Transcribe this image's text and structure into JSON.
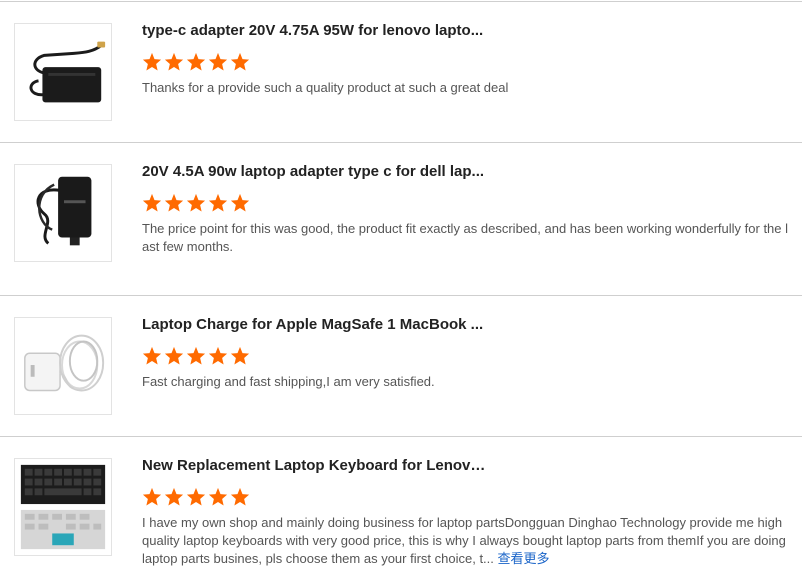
{
  "colors": {
    "star": "#ff6a00",
    "more_link": "#1a64c8",
    "divider": "#cfcfcf"
  },
  "reviews": [
    {
      "title": "type-c adapter 20V 4.75A 95W for lenovo lapto...",
      "rating": 5,
      "text": "Thanks for a provide such a quality product at such a great deal",
      "image_icon": "laptop-adapter-image"
    },
    {
      "title": "20V 4.5A 90w laptop adapter type c for dell lap...",
      "rating": 5,
      "text": "The price point for this was good, the product fit exactly as described, and has been working wonderfully for the last few months.",
      "image_icon": "dell-adapter-image"
    },
    {
      "title": "Laptop Charge for Apple MagSafe 1 MacBook ...",
      "rating": 5,
      "text": "Fast charging and fast shipping,I am very satisfied.",
      "image_icon": "magsafe-charger-image"
    },
    {
      "title": "New Replacement Laptop Keyboard for Lenovo...",
      "rating": 5,
      "text": "I have my own shop and mainly doing business for laptop partsDongguan Dinghao Technology provide me high quality laptop keyboards with very good price, this is why I always bought laptop parts from themIf you are doing laptop parts busines, pls choose them as your first choice, t...",
      "more_label": "查看更多",
      "image_icon": "keyboard-image"
    }
  ]
}
